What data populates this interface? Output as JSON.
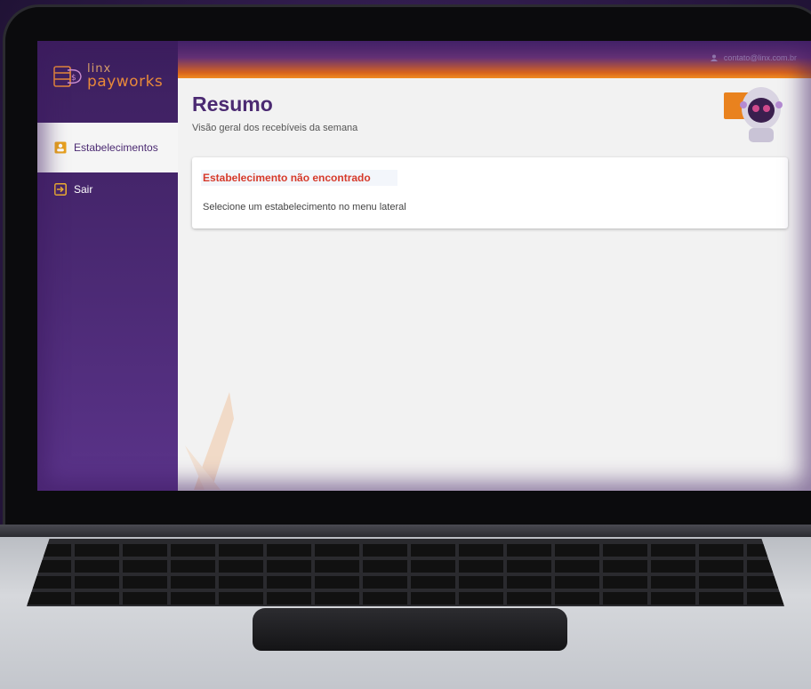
{
  "app": {
    "brand_line1": "linx",
    "brand_line2": "payworks",
    "accent_color": "#4b2a72",
    "orange_color": "#e9821e",
    "error_color": "#d63a2b"
  },
  "sidebar": {
    "items": [
      {
        "label": "Estabelecimentos",
        "icon": "store-icon",
        "active": true
      },
      {
        "label": "Sair",
        "icon": "logout-icon",
        "active": false
      }
    ]
  },
  "header": {
    "user_email": "contato@linx.com.br"
  },
  "main": {
    "title": "Resumo",
    "subtitle": "Visão geral dos recebíveis da semana",
    "card": {
      "title": "Estabelecimento não encontrado",
      "text": "Selecione um estabelecimento no menu lateral"
    }
  }
}
